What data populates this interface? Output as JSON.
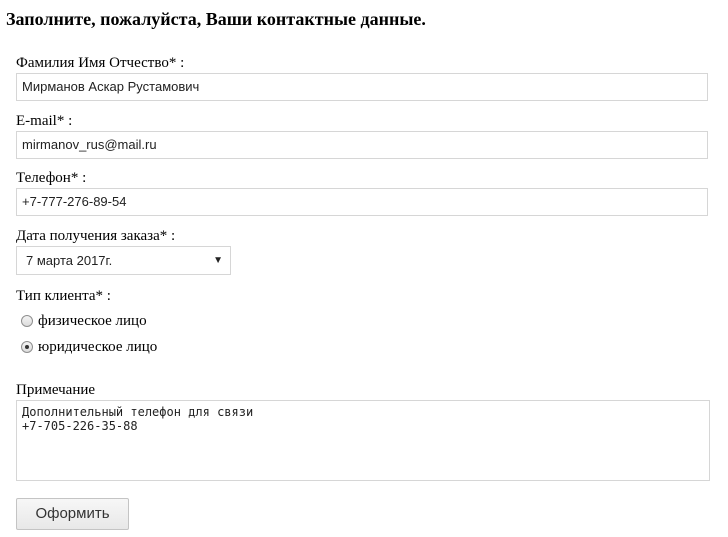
{
  "form": {
    "heading": "Заполните, пожалуйста, Ваши контактные данные.",
    "full_name": {
      "label": "Фамилия Имя Отчество* :",
      "value": "Мирманов Аскар Рустамович"
    },
    "email": {
      "label": "E-mail* :",
      "value": "mirmanov_rus@mail.ru"
    },
    "phone": {
      "label": "Телефон* :",
      "value": "+7-777-276-89-54"
    },
    "order_date": {
      "label": "Дата получения заказа* :",
      "selected": "7 марта 2017г.",
      "arrow_icon": "▼"
    },
    "client_type": {
      "label": "Тип клиента* :",
      "options": [
        {
          "label": "физическое лицо",
          "checked": false
        },
        {
          "label": "юридическое лицо",
          "checked": true
        }
      ]
    },
    "note": {
      "label": "Примечание",
      "value": "Дополнительный телефон для связи\n+7-705-226-35-88"
    },
    "submit_label": "Оформить"
  }
}
